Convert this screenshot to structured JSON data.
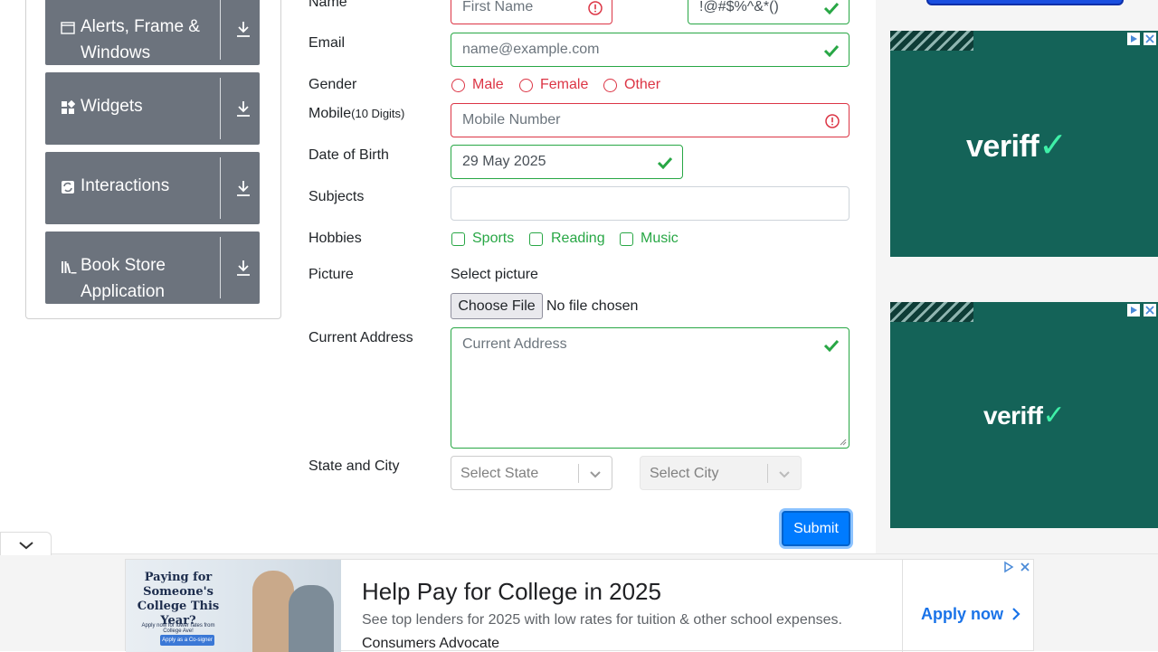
{
  "sidebar": {
    "groups": [
      {
        "label_line1": "Alerts, Frame &",
        "label_line2": "Windows",
        "icon": "window-icon"
      },
      {
        "label": "Widgets",
        "icon": "widgets-icon"
      },
      {
        "label": "Interactions",
        "icon": "interactions-icon"
      },
      {
        "label_line1": "Book Store",
        "label_line2": "Application",
        "icon": "books-icon"
      }
    ]
  },
  "form": {
    "name_label": "Name",
    "first_name_placeholder": "First Name",
    "last_name_value": "!@#$%^&*()",
    "email_label": "Email",
    "email_placeholder": "name@example.com",
    "gender_label": "Gender",
    "gender_options": [
      "Male",
      "Female",
      "Other"
    ],
    "mobile_label": "Mobile",
    "mobile_hint": "(10 Digits)",
    "mobile_placeholder": "Mobile Number",
    "dob_label": "Date of Birth",
    "dob_value": "29 May 2025",
    "subjects_label": "Subjects",
    "hobbies_label": "Hobbies",
    "hobbies": [
      "Sports",
      "Reading",
      "Music"
    ],
    "picture_label": "Picture",
    "select_picture": "Select picture",
    "choose_file": "Choose File",
    "no_file": "No file chosen",
    "address_label": "Current Address",
    "address_placeholder": "Current Address",
    "state_city_label": "State and City",
    "state_placeholder": "Select State",
    "city_placeholder": "Select City",
    "submit": "Submit"
  },
  "ads": {
    "logo_text": "veriff",
    "banner": {
      "image_headline": "Paying for Someone's College This Year?",
      "image_small": "Apply now for lower rates from College Ave!",
      "image_button": "Apply as a Co-signer",
      "title": "Help Pay for College in 2025",
      "subtitle": "See top lenders for 2025 with low rates for tuition & other school expenses.",
      "brand": "Consumers Advocate",
      "cta": "Apply now"
    }
  },
  "colors": {
    "valid": "#28a745",
    "invalid": "#dc3545",
    "primary": "#007bff",
    "sidebar_group": "#6c737d",
    "ad_bg": "#146358",
    "ad_accent": "#3ff0a8"
  }
}
